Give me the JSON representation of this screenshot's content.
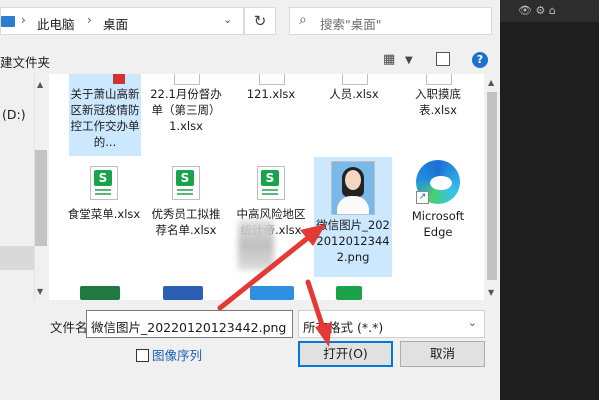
{
  "address": {
    "crumbs": [
      "此电脑",
      "桌面"
    ]
  },
  "search": {
    "placeholder": "搜索\"桌面\""
  },
  "toolbar": {
    "new_folder": "建文件夹"
  },
  "side": {
    "drive": "(D:)"
  },
  "files": {
    "row1": [
      {
        "name": "关于萧山高新区新冠疫情防控工作交办单的...",
        "selected": true
      },
      {
        "name": "22.1月份督办单（第三周）1.xlsx"
      },
      {
        "name": "121.xlsx"
      },
      {
        "name": "人员.xlsx"
      },
      {
        "name": "入职摸底表.xlsx"
      }
    ],
    "row2": [
      {
        "name": "食堂菜单.xlsx",
        "icon": "spreadsheet-icon"
      },
      {
        "name": "优秀员工拟推荐名单.xlsx",
        "icon": "spreadsheet-icon"
      },
      {
        "name": "中高风险地区统计帝.xlsx",
        "icon": "spreadsheet-icon"
      },
      {
        "name": "微信图片_20220120123442.png",
        "icon": "photo-thumbnail",
        "selected": true
      },
      {
        "name": "Microsoft Edge",
        "icon": "edge-icon"
      }
    ]
  },
  "bottom": {
    "filename_label": "文件名(N):",
    "filename_value": "微信图片_20220120123442.png",
    "filetype_value": "所有格式 (*.*)",
    "image_sequence": "图像序列",
    "open_button": "打开(O)",
    "cancel_button": "取消"
  },
  "colors": {
    "selection": "#cce8ff",
    "accent": "#0078d7",
    "annotation_arrow": "#e53935",
    "spreadsheet": "#1aa34a"
  }
}
